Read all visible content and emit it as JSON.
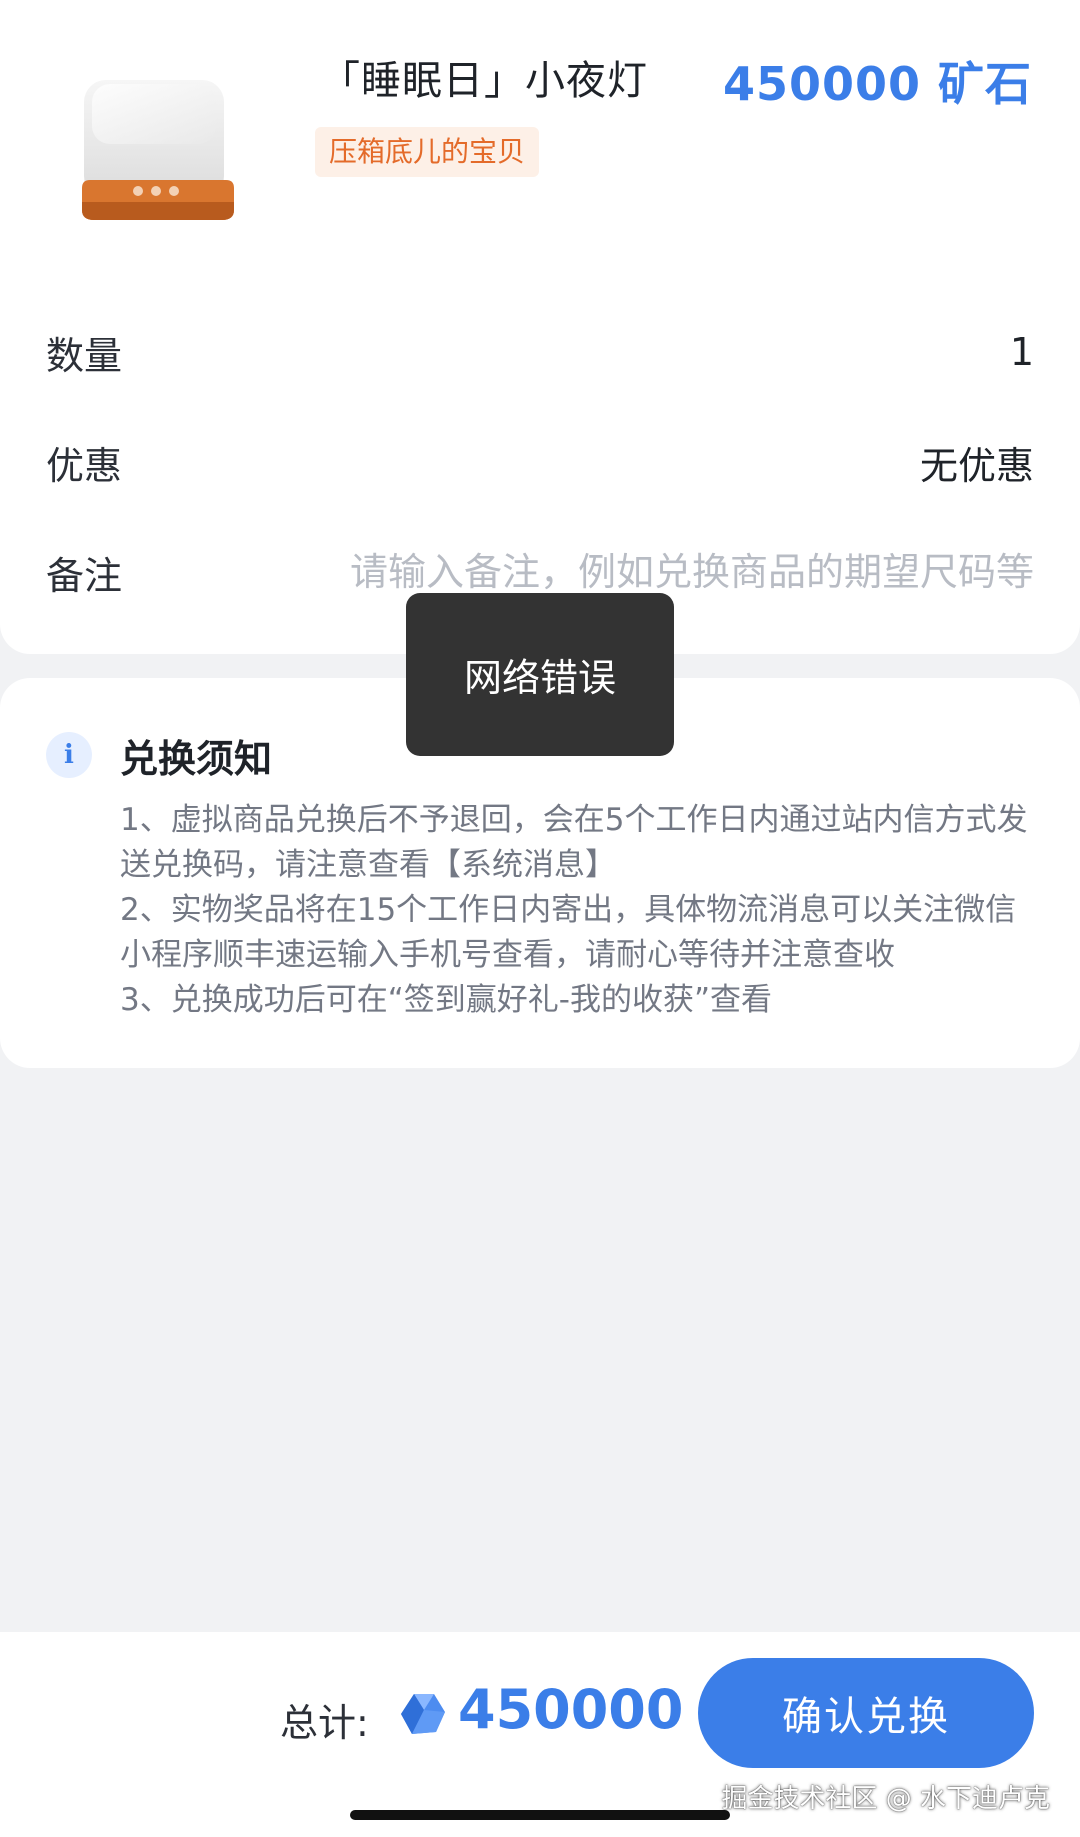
{
  "product": {
    "title": "「睡眠日」小夜灯",
    "price": "450000 矿石",
    "tag": "压箱底儿的宝贝"
  },
  "order": {
    "quantity_label": "数量",
    "quantity_value": "1",
    "discount_label": "优惠",
    "discount_value": "无优惠",
    "remark_label": "备注",
    "remark_placeholder": "请输入备注，例如兑换商品的期望尺码等"
  },
  "toast": {
    "message": "网络错误"
  },
  "notice": {
    "title": "兑换须知",
    "lines": [
      "1、虚拟商品兑换后不予退回，会在5个工作日内通过站内信方式发送兑换码，请注意查看【系统消息】",
      "2、实物奖品将在15个工作日内寄出，具体物流消息可以关注微信小程序顺丰速运输入手机号查看，请耐心等待并注意查收",
      "3、兑换成功后可在“签到赢好礼-我的收获”查看"
    ]
  },
  "footer": {
    "total_label": "总计:",
    "total_value": "450000",
    "confirm_label": "确认兑换",
    "watermark": "掘金技术社区 @ 水下迪卢克"
  },
  "colors": {
    "accent": "#3b7ee8",
    "tag_text": "#e46b2a",
    "tag_bg": "#fdf0e7",
    "background": "#f1f2f4"
  },
  "icons": {
    "notice": "info-icon",
    "currency": "ore-gem-icon"
  }
}
